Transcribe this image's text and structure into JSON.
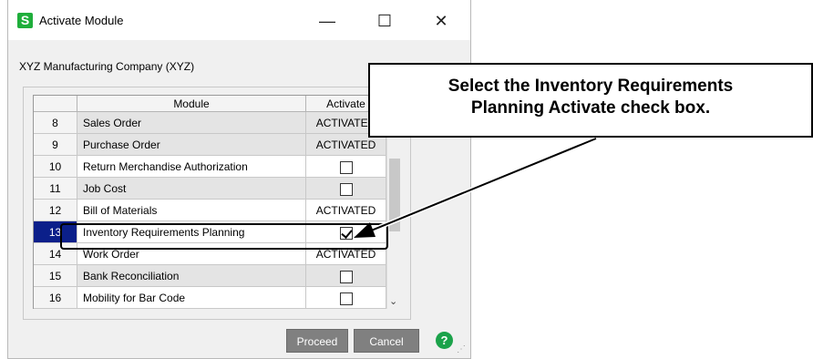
{
  "window": {
    "title": "Activate Module",
    "app_icon_letter": "S",
    "minimize": "—",
    "maximize": "☐",
    "close": "✕"
  },
  "company": "XYZ Manufacturing Company (XYZ)",
  "grid": {
    "headers": [
      "",
      "Module",
      "Activate"
    ],
    "rows": [
      {
        "num": "8",
        "module": "Sales Order",
        "activate": "ACTIVATED"
      },
      {
        "num": "9",
        "module": "Purchase Order",
        "activate": "ACTIVATED"
      },
      {
        "num": "10",
        "module": "Return Merchandise Authorization",
        "activate": ""
      },
      {
        "num": "11",
        "module": "Job Cost",
        "activate": ""
      },
      {
        "num": "12",
        "module": "Bill of Materials",
        "activate": "ACTIVATED"
      },
      {
        "num": "13",
        "module": "Inventory Requirements Planning",
        "activate": ""
      },
      {
        "num": "14",
        "module": "Work Order",
        "activate": "ACTIVATED"
      },
      {
        "num": "15",
        "module": "Bank Reconciliation",
        "activate": ""
      },
      {
        "num": "16",
        "module": "Mobility for Bar Code",
        "activate": ""
      }
    ]
  },
  "buttons": {
    "proceed": "Proceed",
    "cancel": "Cancel",
    "help": "?"
  },
  "callout": {
    "line1": "Select the Inventory Requirements",
    "line2": "Planning Activate check box."
  },
  "colors": {
    "selected_row": "#0b1f8a",
    "help_icon": "#1ba24a",
    "app_icon": "#1fae3b"
  }
}
